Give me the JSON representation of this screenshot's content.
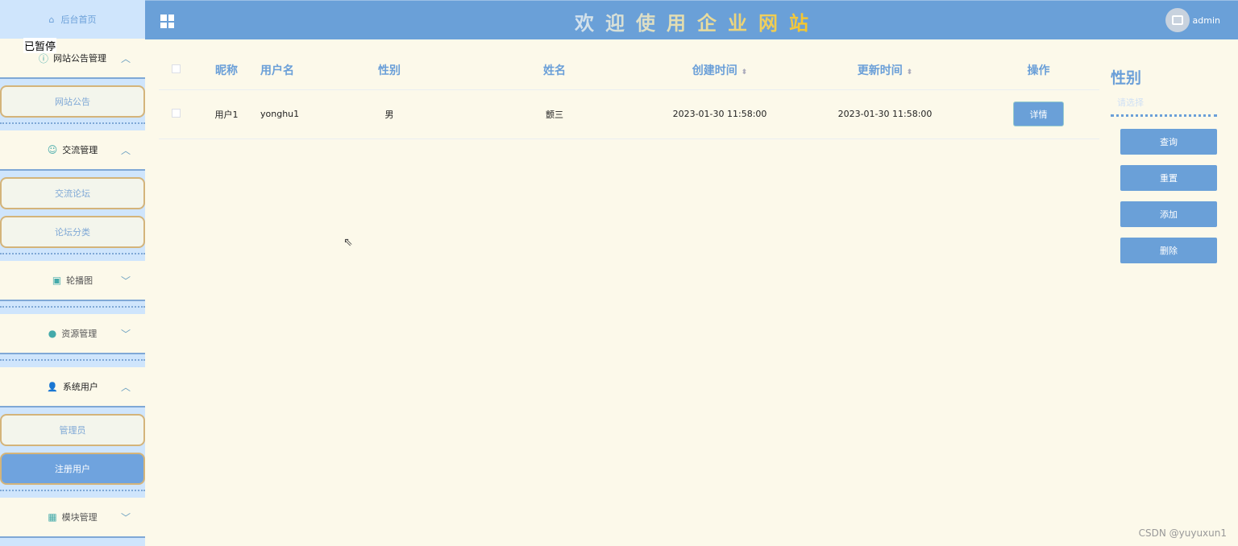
{
  "sidebar": {
    "home": "后台首页",
    "paused": "已暂停",
    "groups": [
      {
        "label": "网站公告管理",
        "items": [
          "网站公告"
        ]
      },
      {
        "label": "交流管理",
        "items": [
          "交流论坛",
          "论坛分类"
        ]
      },
      {
        "label": "轮播图"
      },
      {
        "label": "资源管理"
      },
      {
        "label": "系统用户",
        "items": [
          "管理员",
          "注册用户"
        ]
      },
      {
        "label": "模块管理"
      }
    ]
  },
  "header": {
    "title": "欢迎使用企业网站",
    "user": "admin"
  },
  "table": {
    "columns": [
      "昵称",
      "用户名",
      "性别",
      "姓名",
      "创建时间",
      "更新时间",
      "操作"
    ],
    "rows": [
      {
        "nickname": "用户1",
        "username": "yonghu1",
        "gender": "男",
        "name": "颤三",
        "created": "2023-01-30 11:58:00",
        "updated": "2023-01-30 11:58:00",
        "action": "详情"
      }
    ]
  },
  "filter": {
    "label": "性别",
    "placeholder": "请选择",
    "buttons": [
      "查询",
      "重置",
      "添加",
      "删除"
    ]
  },
  "watermark": "CSDN @yuyuxun1"
}
